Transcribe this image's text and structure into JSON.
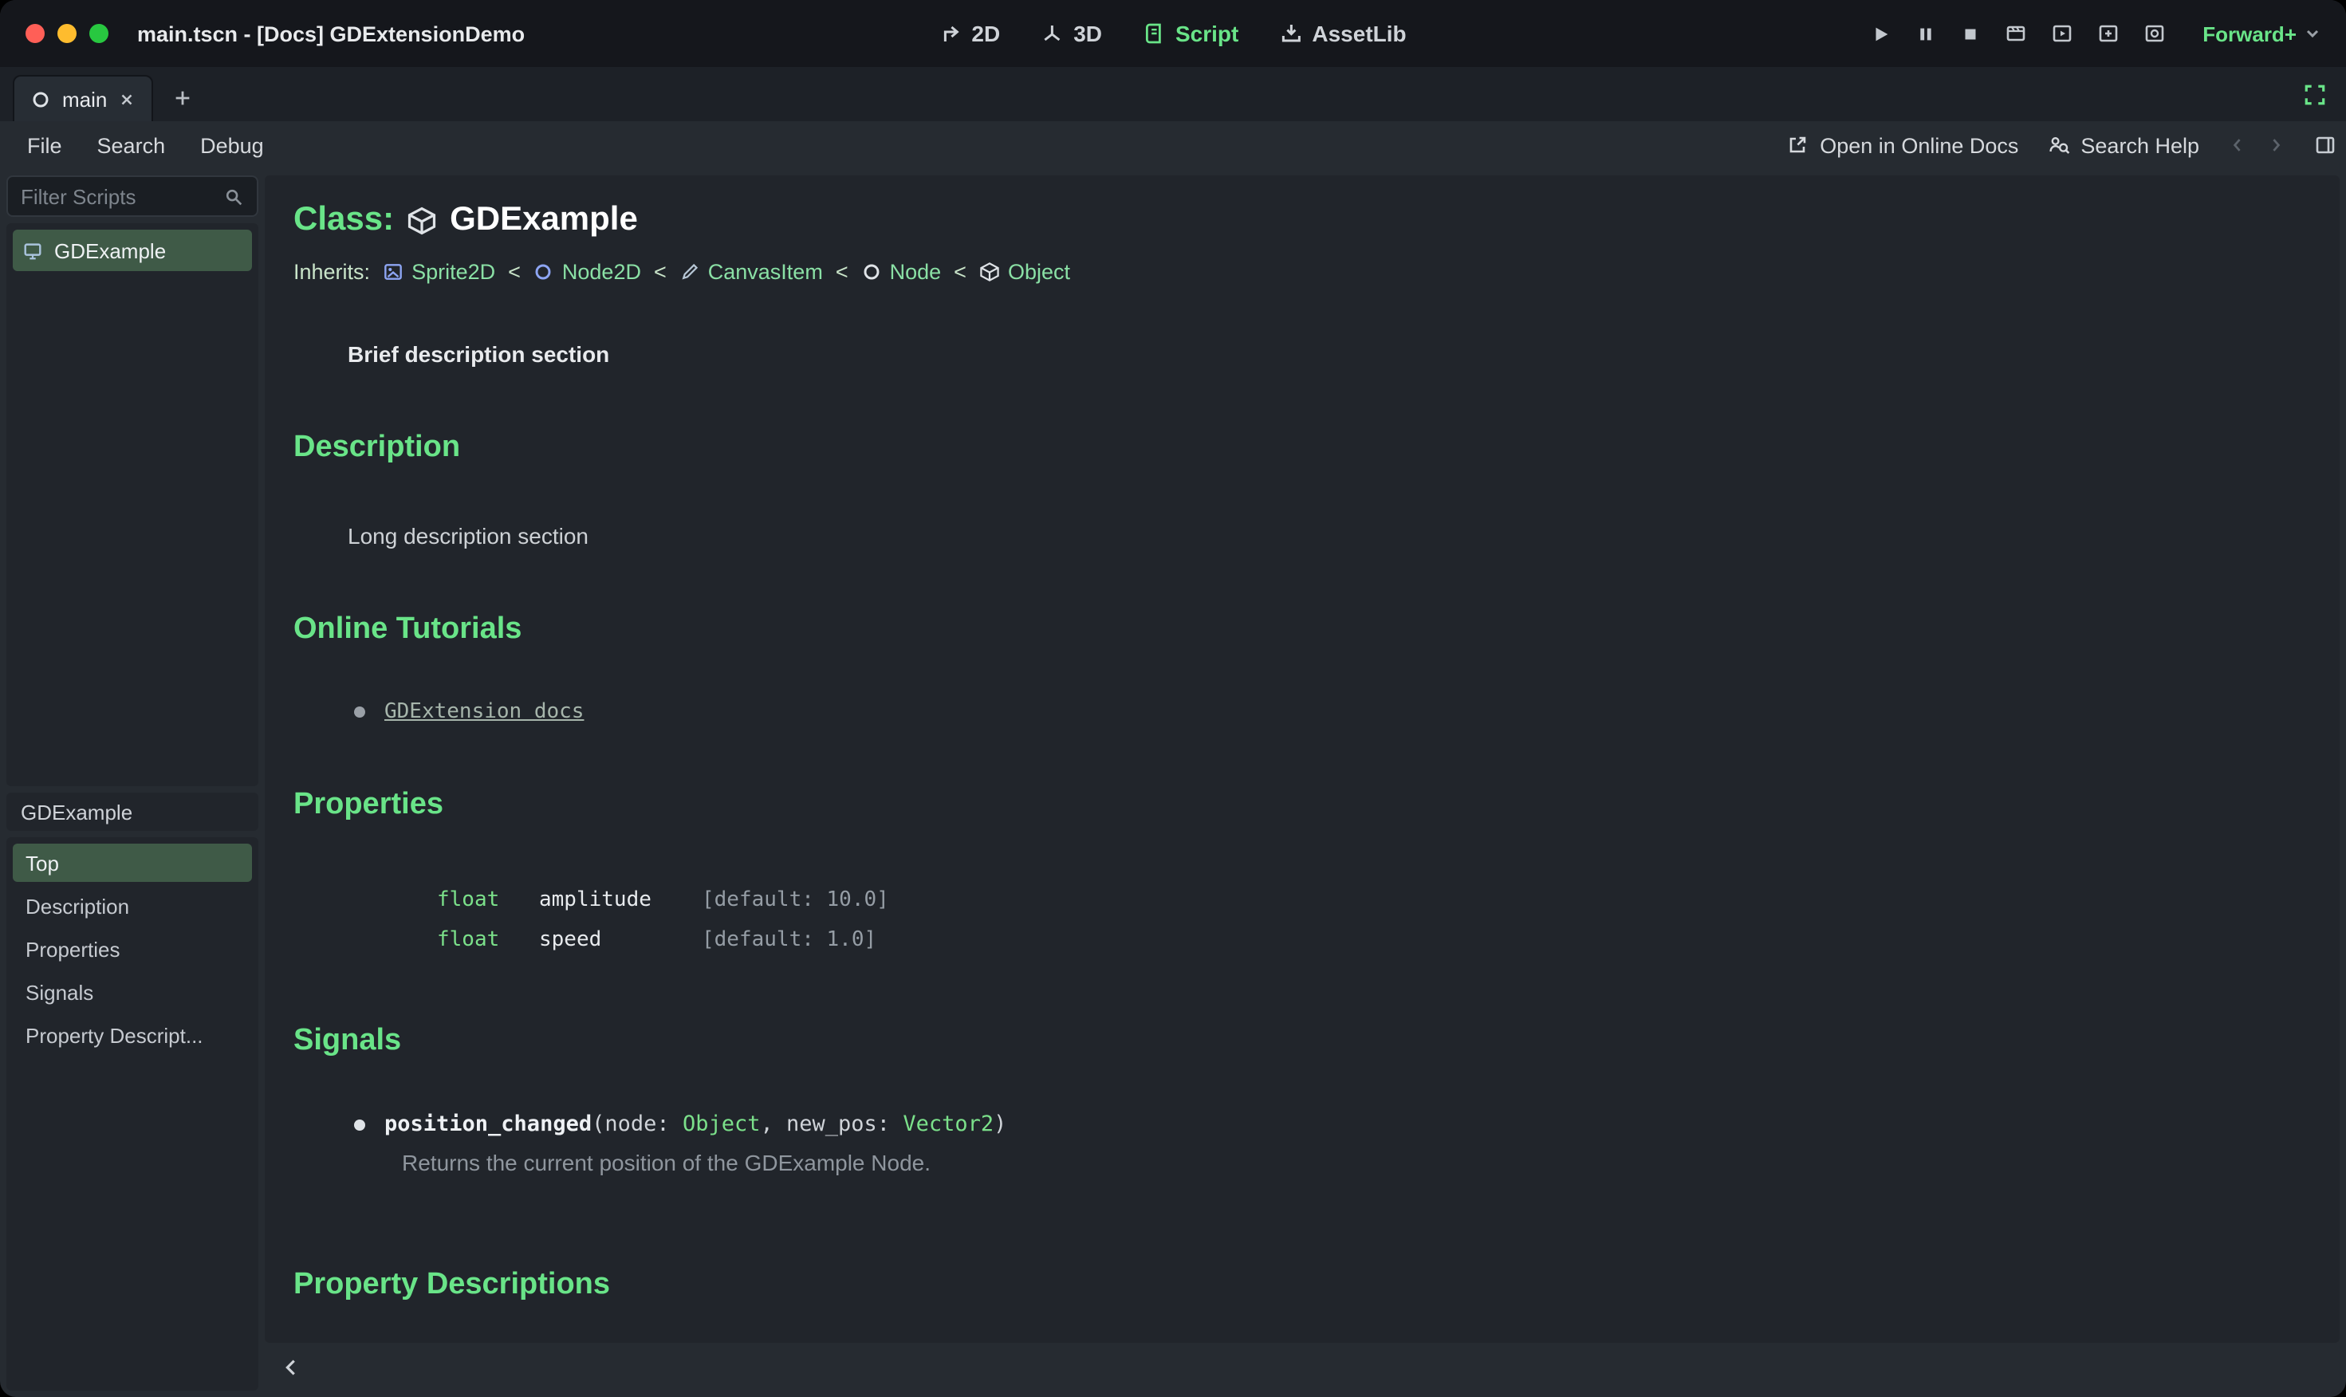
{
  "window": {
    "title": "main.tscn - [Docs] GDExtensionDemo"
  },
  "toolbar": {
    "nav": [
      {
        "label": "2D"
      },
      {
        "label": "3D"
      },
      {
        "label": "Script"
      },
      {
        "label": "AssetLib"
      }
    ],
    "renderer": "Forward+"
  },
  "tabbar": {
    "tab": "main"
  },
  "menubar": {
    "items": [
      "File",
      "Search",
      "Debug"
    ],
    "open_online_docs": "Open in Online Docs",
    "search_help": "Search Help"
  },
  "sidebar": {
    "filter_placeholder": "Filter Scripts",
    "scripts": [
      {
        "label": "GDExample"
      }
    ],
    "members_header": "GDExample",
    "members": [
      "Top",
      "Description",
      "Properties",
      "Signals",
      "Property Descript..."
    ]
  },
  "doc": {
    "class_label": "Class:",
    "class_name": "GDExample",
    "inherits_label": "Inherits:",
    "separator": "<",
    "inherits": [
      {
        "name": "Sprite2D"
      },
      {
        "name": "Node2D"
      },
      {
        "name": "CanvasItem"
      },
      {
        "name": "Node"
      },
      {
        "name": "Object"
      }
    ],
    "brief": "Brief description section",
    "description_title": "Description",
    "description_body": "Long description section",
    "tutorials_title": "Online Tutorials",
    "tutorial_link": "GDExtension docs",
    "properties_title": "Properties",
    "properties": [
      {
        "type": "float",
        "name": "amplitude",
        "default": "[default: 10.0]"
      },
      {
        "type": "float",
        "name": "speed",
        "default": "[default: 1.0]"
      }
    ],
    "signals_title": "Signals",
    "signal": {
      "name": "position_changed",
      "open": "(",
      "p1_label": "node: ",
      "p1_type": "Object",
      "p2_label": ", new_pos: ",
      "p2_type": "Vector2",
      "close": ")",
      "description": "Returns the current position of the GDExample Node."
    },
    "property_descriptions_title": "Property Descriptions"
  }
}
